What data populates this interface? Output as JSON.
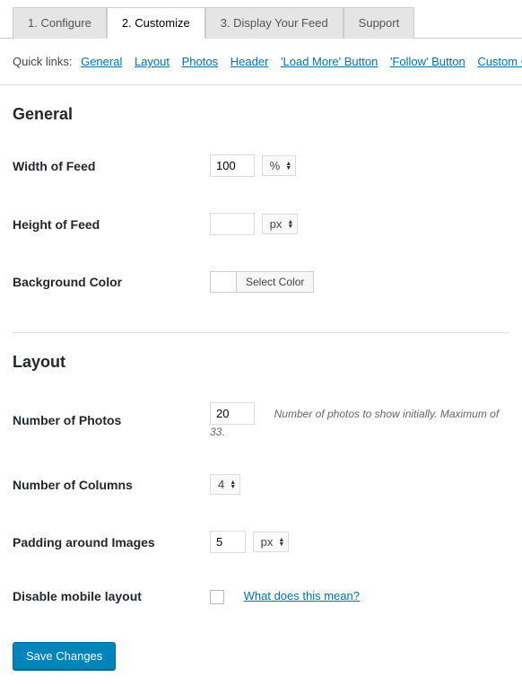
{
  "tabs": {
    "configure": "1. Configure",
    "customize": "2. Customize",
    "display": "3. Display Your Feed",
    "support": "Support"
  },
  "quicklinks": {
    "label": "Quick links:",
    "general": "General",
    "layout": "Layout",
    "photos": "Photos",
    "header": "Header",
    "loadmore": "'Load More' Button",
    "follow": "'Follow' Button",
    "custom": "Custom C"
  },
  "general": {
    "heading": "General",
    "width_label": "Width of Feed",
    "width_value": "100",
    "width_unit": "%",
    "height_label": "Height of Feed",
    "height_value": "",
    "height_unit": "px",
    "bgcolor_label": "Background Color",
    "bgcolor_btn": "Select Color"
  },
  "layout": {
    "heading": "Layout",
    "num_photos_label": "Number of Photos",
    "num_photos_value": "20",
    "num_photos_desc": "Number of photos to show initially. Maximum of 33.",
    "num_cols_label": "Number of Columns",
    "num_cols_value": "4",
    "padding_label": "Padding around Images",
    "padding_value": "5",
    "padding_unit": "px",
    "disable_mobile_label": "Disable mobile layout",
    "disable_mobile_link": "What does this mean?"
  },
  "buttons": {
    "save": "Save Changes"
  }
}
